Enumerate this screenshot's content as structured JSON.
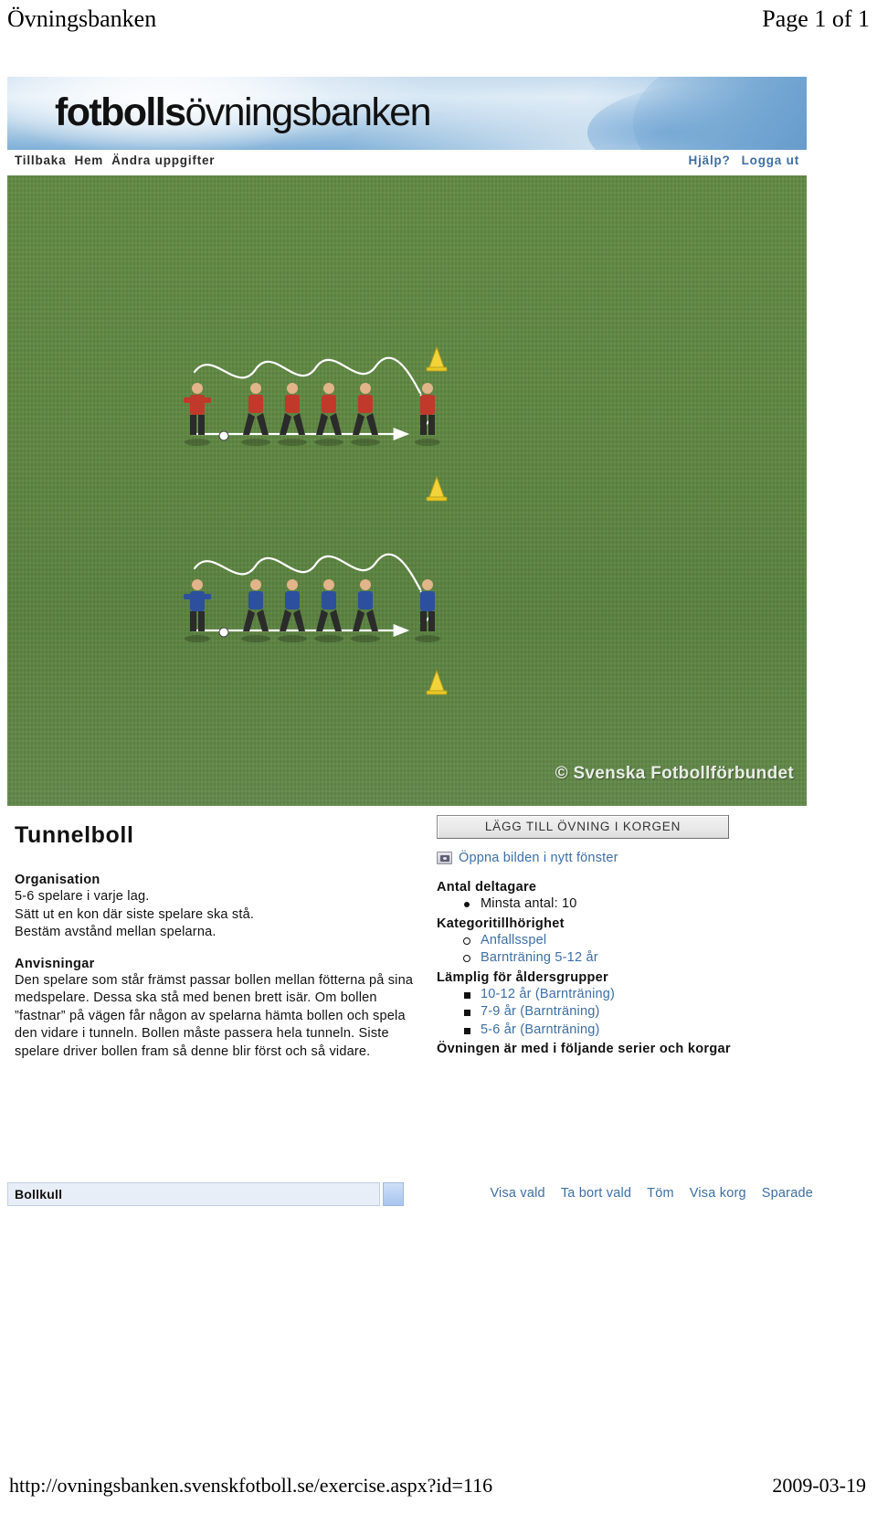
{
  "print": {
    "header_left": "Övningsbanken",
    "header_right": "Page 1 of 1",
    "footer_url": "http://ovningsbanken.svenskfotboll.se/exercise.aspx?id=116",
    "footer_date": "2009-03-19"
  },
  "logo": {
    "bold_part": "fotbolls",
    "light_part": "övningsbanken"
  },
  "nav": {
    "left": [
      {
        "label": "Tillbaka"
      },
      {
        "label": "Hem"
      },
      {
        "label": "Ändra uppgifter"
      }
    ],
    "right": [
      {
        "label": "Hjälp?"
      },
      {
        "label": "Logga ut"
      }
    ]
  },
  "field": {
    "watermark": "© Svenska Fotbollförbundet"
  },
  "exercise": {
    "title": "Tunnelboll",
    "organisation_heading": "Organisation",
    "organisation_lines": [
      "5-6 spelare i varje lag.",
      "Sätt ut en kon där siste spelare ska stå.",
      "Bestäm avstånd mellan spelarna."
    ],
    "instructions_heading": "Anvisningar",
    "instructions_text": "Den spelare som står främst passar bollen mellan fötterna på sina medspelare. Dessa ska stå med benen brett isär. Om bollen ”fastnar” på vägen får någon av spelarna hämta bollen och spela den vidare i tunneln. Bollen måste passera hela tunneln. Siste spelare driver bollen fram så denne blir först och så vidare."
  },
  "sidebar": {
    "add_button": "LÄGG TILL ÖVNING I KORGEN",
    "open_image_link": "Öppna bilden i nytt fönster",
    "participants_heading": "Antal deltagare",
    "participants": [
      "Minsta antal: 10"
    ],
    "category_heading": "Kategoritillhörighet",
    "categories": [
      "Anfallsspel",
      "Barnträning 5-12 år"
    ],
    "agegroup_heading": "Lämplig för åldersgrupper",
    "agegroups": [
      "10-12 år (Barnträning)",
      "7-9 år (Barnträning)",
      "5-6 år (Barnträning)"
    ],
    "series_heading": "Övningen är med i följande serier och korgar"
  },
  "basket": {
    "name": "Bollkull",
    "actions": [
      {
        "label": "Visa vald"
      },
      {
        "label": "Ta bort vald"
      },
      {
        "label": "Töm"
      },
      {
        "label": "Visa korg"
      },
      {
        "label": "Sparade"
      }
    ]
  }
}
